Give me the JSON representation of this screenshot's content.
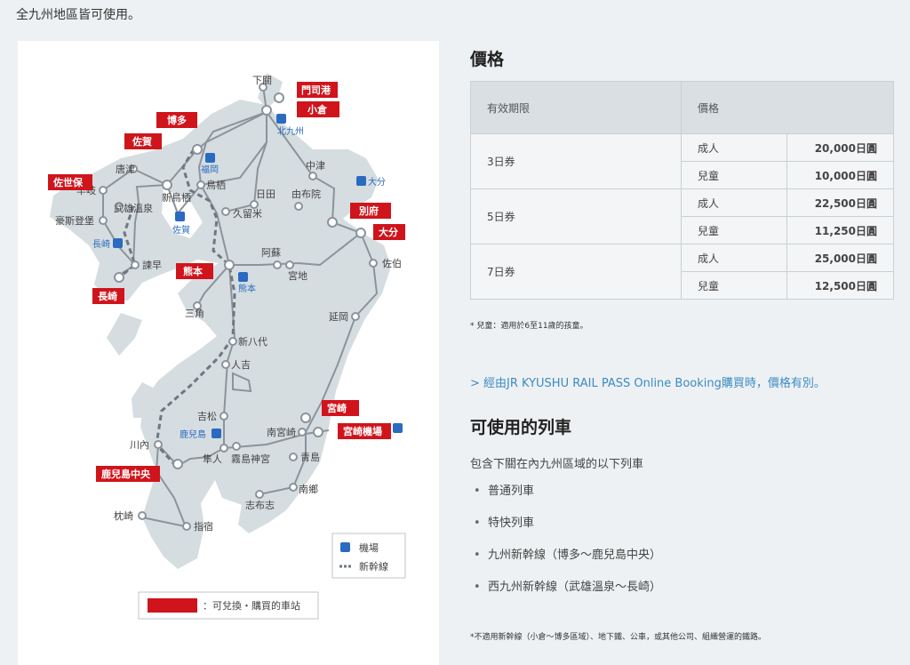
{
  "intro_text": "全九州地區皆可使用。",
  "map": {
    "stations": {
      "shimonoseki": "下關",
      "mojiko": "門司港",
      "kokura": "小倉",
      "hakata": "博多",
      "saga": "佐賀",
      "karatsu": "唐津",
      "sasebo": "佐世保",
      "haiki": "早岐",
      "huis": "豪斯登堡",
      "takeo": "武雄溫泉",
      "shintosu": "新鳥栖",
      "tosu": "鳥栖",
      "nakatsu": "中津",
      "hita": "日田",
      "yufuin": "由布院",
      "kurume": "久留米",
      "beppu": "別府",
      "oita": "大分",
      "saiki": "佐伯",
      "isahaya": "諫早",
      "nagasaki": "長崎",
      "kumamoto": "熊本",
      "aso": "阿蘇",
      "miyaji": "宮地",
      "misumi": "三角",
      "nobeoka": "延岡",
      "shinyatsushiro": "新八代",
      "hitoyoshi": "人吉",
      "yoshimatsu": "吉松",
      "sendai": "川內",
      "miyazaki": "宮崎",
      "minamimiyazaki": "南宮崎",
      "miyazaki_airport": "宮崎機場",
      "hayato": "隼人",
      "kirishima": "霧島神宮",
      "aoshima": "青島",
      "kagoshimachuo": "鹿兒島中央",
      "nango": "南鄉",
      "shibushi": "志布志",
      "makurazaki": "枕崎",
      "ibusuki": "指宿"
    },
    "airports": {
      "kitakyushu": "北九州",
      "fukuoka": "福岡",
      "oita": "大分",
      "saga": "佐賀",
      "nagasaki": "長崎",
      "kumamoto": "熊本",
      "kagoshima": "鹿兒島"
    },
    "legend": {
      "airport": "機場",
      "shinkansen": "新幹線",
      "exchange": "：可兌換・購買的車站"
    }
  },
  "price": {
    "heading": "價格",
    "col_period": "有效期限",
    "col_price": "價格",
    "rows": [
      {
        "period": "3日券",
        "adult_label": "成人",
        "adult": "20,000日圓",
        "child_label": "兒童",
        "child": "10,000日圓"
      },
      {
        "period": "5日券",
        "adult_label": "成人",
        "adult": "22,500日圓",
        "child_label": "兒童",
        "child": "11,250日圓"
      },
      {
        "period": "7日券",
        "adult_label": "成人",
        "adult": "25,000日圓",
        "child_label": "兒童",
        "child": "12,500日圓"
      }
    ],
    "note": "* 兒童：適用於6至11歲的孩童。"
  },
  "online_link": "> 經由JR KYUSHU RAIL PASS Online Booking購買時，價格有別。",
  "trains": {
    "heading": "可使用的列車",
    "description": "包含下關在內九州區域的以下列車",
    "items": [
      "普通列車",
      "特快列車",
      "九州新幹線（博多～鹿兒島中央）",
      "西九州新幹線（武雄溫泉～長崎）"
    ],
    "note": "*不適用新幹線（小倉～博多區域）、地下鐵、公車，或其他公司、組織營運的鐵路。"
  },
  "colors": {
    "accent_red": "#d0141c",
    "link_blue": "#3b8bc4",
    "rail_gray": "#8a949b",
    "land": "#d6dde1"
  }
}
